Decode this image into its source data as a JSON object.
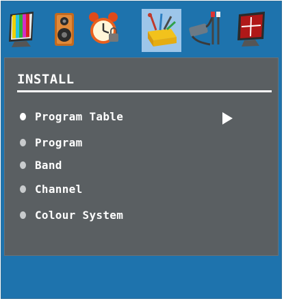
{
  "window": {
    "title": "INSTALL"
  },
  "tabs": [
    {
      "name": "picture",
      "icon": "tv-color-bars-icon",
      "active": false
    },
    {
      "name": "sound",
      "icon": "speaker-icon",
      "active": false
    },
    {
      "name": "timer",
      "icon": "alarm-clock-icon",
      "active": false
    },
    {
      "name": "install",
      "icon": "toolbox-icon",
      "active": true
    },
    {
      "name": "source",
      "icon": "av-cables-icon",
      "active": false
    },
    {
      "name": "setup",
      "icon": "monitor-cross-icon",
      "active": false
    }
  ],
  "menu": {
    "items": [
      {
        "label": "Program Table",
        "selected": true
      },
      {
        "label": "Program",
        "selected": false
      },
      {
        "label": "Band",
        "selected": false
      },
      {
        "label": "Channel",
        "selected": false
      },
      {
        "label": "Colour System",
        "selected": false
      }
    ]
  },
  "colors": {
    "frame": "#1e73ad",
    "panel": "#5a5f62",
    "active_tab": "#9dc6ea",
    "text": "#ffffff"
  }
}
